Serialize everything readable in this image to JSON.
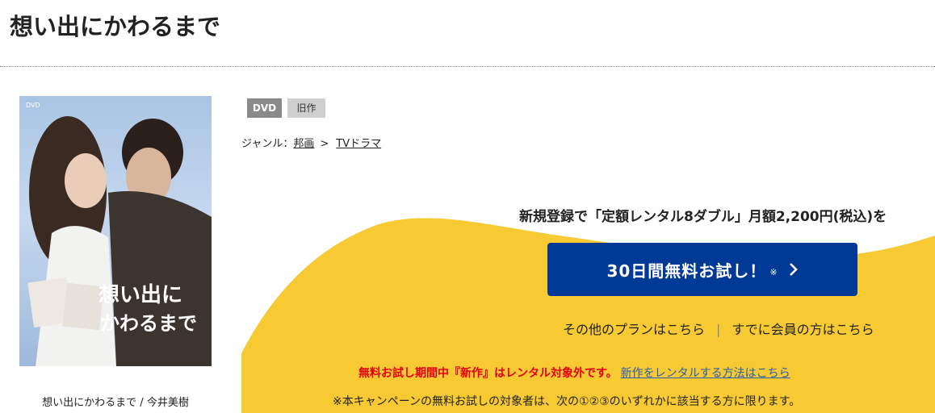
{
  "page": {
    "title": "想い出にかわるまで"
  },
  "product": {
    "caption": "想い出にかわるまで / 今井美樹",
    "cover_title_line1": "想い出に",
    "cover_title_line2": "かわるまで",
    "cover_badge": "DVD"
  },
  "tags": {
    "format": "DVD",
    "status": "旧作"
  },
  "genre": {
    "label": "ジャンル：",
    "items": [
      "邦画",
      "TVドラマ"
    ],
    "separator": ">"
  },
  "campaign": {
    "plan_text": "新規登録で「定額レンタル8ダブル」月額2,200円(税込)を",
    "trial_button": "30日間無料お試し！",
    "trial_note": "※",
    "other_plans": "その他のプランはこちら",
    "divider": "|",
    "member_link": "すでに会員の方はこちら",
    "warning_red": "無料お試し期間中『新作』はレンタル対象外です。",
    "warning_link": "新作をレンタルする方法はこちら",
    "eligibility": "※本キャンペーンの無料お試しの対象者は、次の①②③のいずれかに該当する方に限ります。"
  },
  "colors": {
    "accent_blue": "#003a96",
    "campaign_yellow": "#f7c932",
    "warning_red": "#e60012",
    "link_blue": "#2a5db0"
  },
  "icons": {
    "trial_arrow": "chevron-right-icon"
  }
}
